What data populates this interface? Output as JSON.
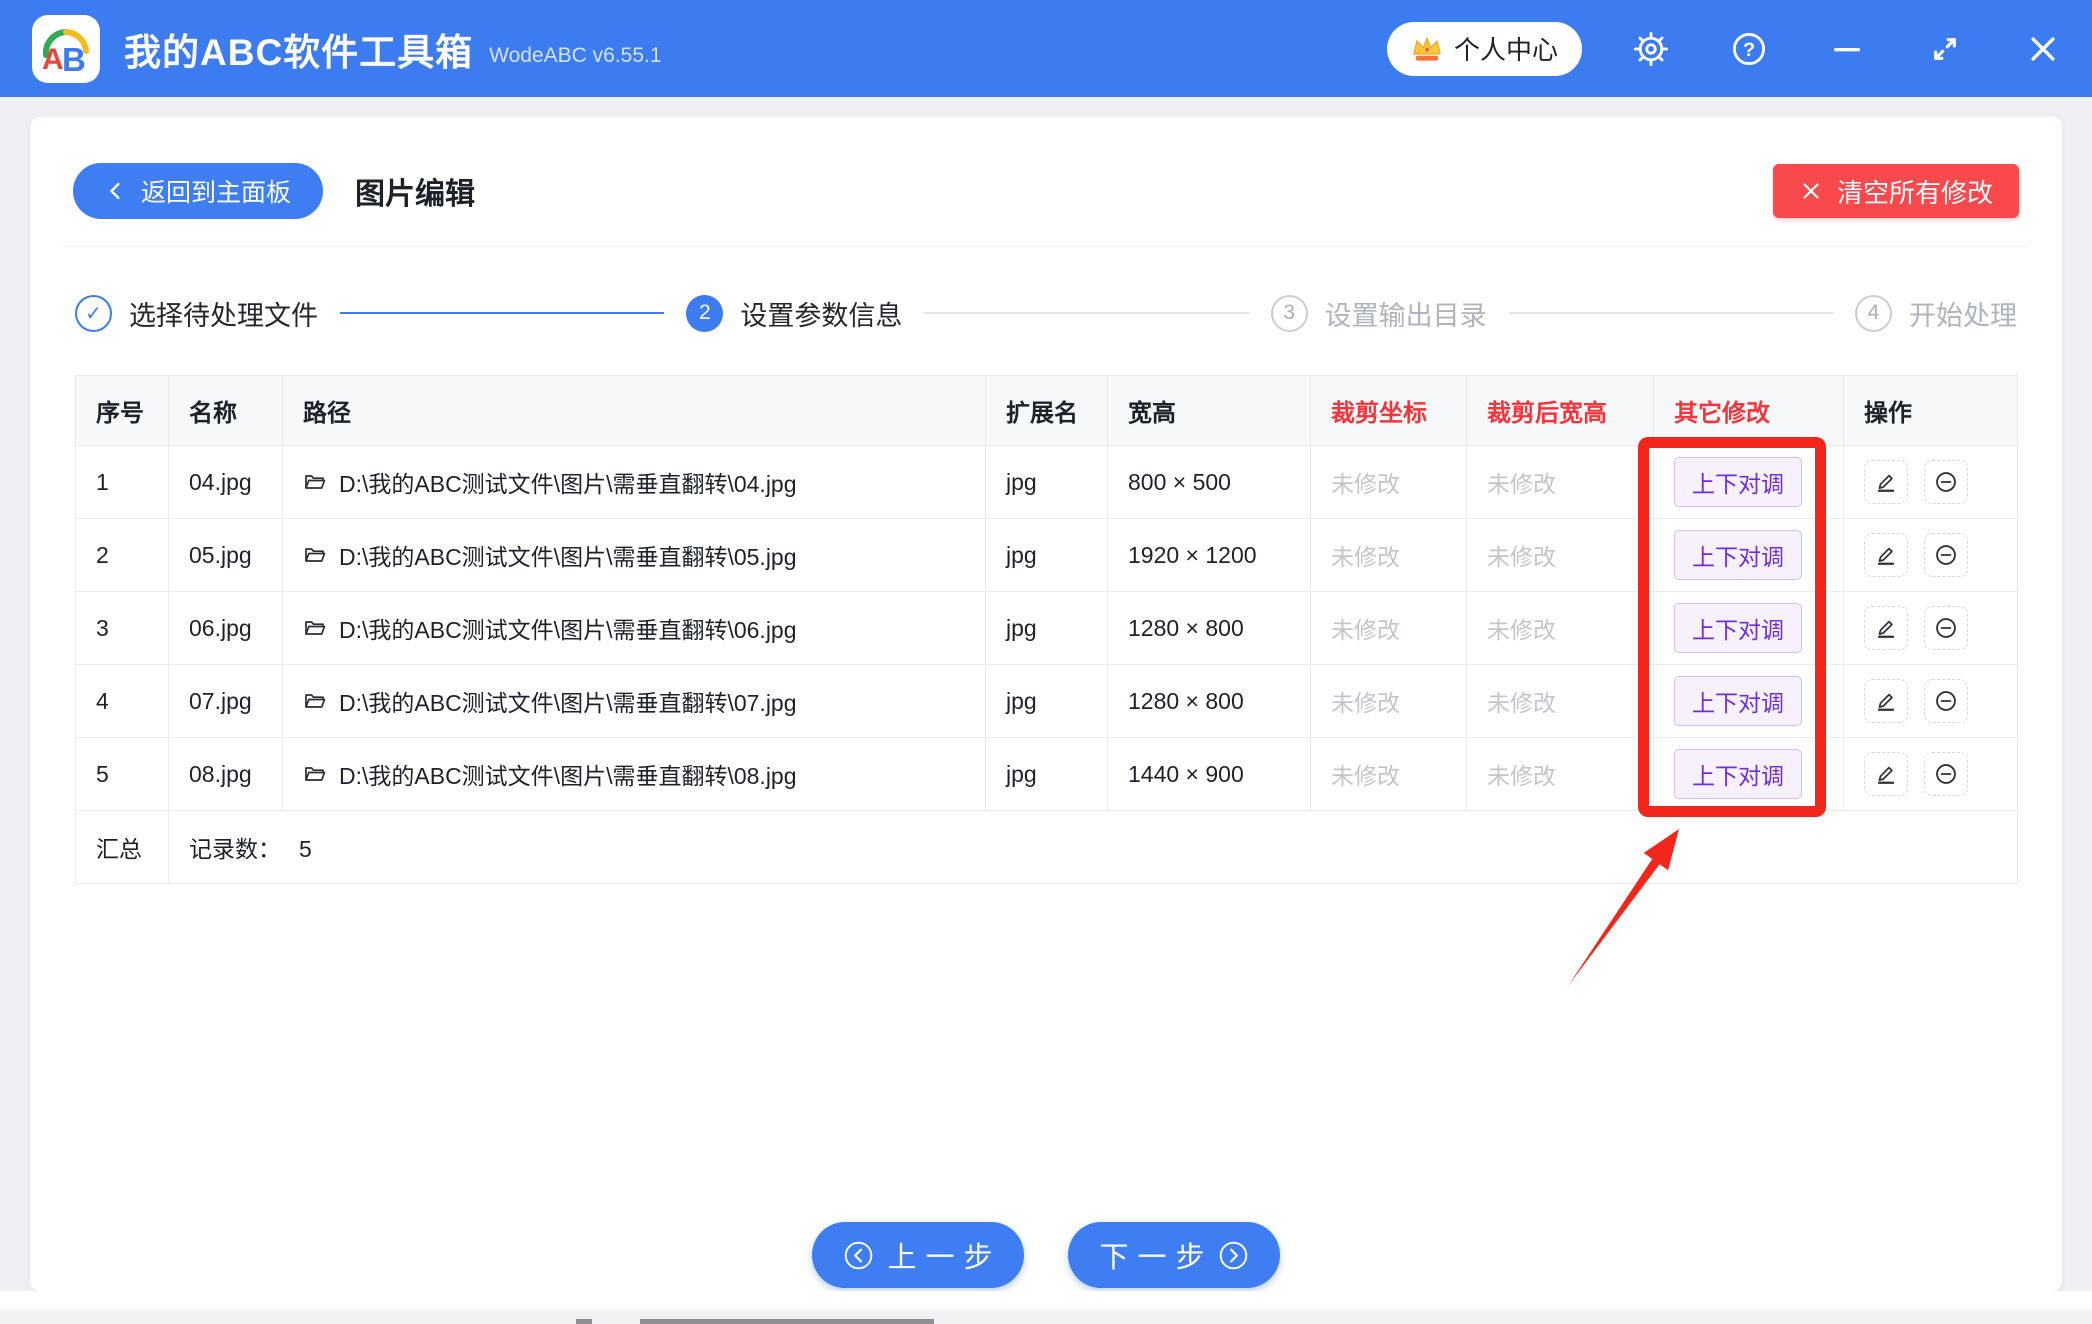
{
  "colors": {
    "accent": "#3C7BF0",
    "danger": "#F9494D",
    "annotation_red": "#F3261B",
    "header_red": "#F5353B",
    "badge_text": "#6C2FD9",
    "badge_bg": "#F7F1FE"
  },
  "header": {
    "app_title": "我的ABC软件工具箱",
    "version": "WodeABC v6.55.1",
    "personal_center": "个人中心",
    "logo_text": "AB"
  },
  "toolbar": {
    "back_label": "返回到主面板",
    "page_title": "图片编辑",
    "clear_label": "清空所有修改"
  },
  "steps": {
    "check": "✓",
    "s1_label": "选择待处理文件",
    "s2_num": "2",
    "s2_label": "设置参数信息",
    "s3_num": "3",
    "s3_label": "设置输出目录",
    "s4_num": "4",
    "s4_label": "开始处理"
  },
  "table": {
    "headers": {
      "index": "序号",
      "name": "名称",
      "path": "路径",
      "ext": "扩展名",
      "size": "宽高",
      "crop_pos": "裁剪坐标",
      "crop_size": "裁剪后宽高",
      "other": "其它修改",
      "actions": "操作"
    },
    "rows": [
      {
        "index": "1",
        "name": "04.jpg",
        "path": "D:\\我的ABC测试文件\\图片\\需垂直翻转\\04.jpg",
        "ext": "jpg",
        "size": "800 × 500",
        "crop_pos": "未修改",
        "crop_size": "未修改",
        "other": "上下对调"
      },
      {
        "index": "2",
        "name": "05.jpg",
        "path": "D:\\我的ABC测试文件\\图片\\需垂直翻转\\05.jpg",
        "ext": "jpg",
        "size": "1920 × 1200",
        "crop_pos": "未修改",
        "crop_size": "未修改",
        "other": "上下对调"
      },
      {
        "index": "3",
        "name": "06.jpg",
        "path": "D:\\我的ABC测试文件\\图片\\需垂直翻转\\06.jpg",
        "ext": "jpg",
        "size": "1280 × 800",
        "crop_pos": "未修改",
        "crop_size": "未修改",
        "other": "上下对调"
      },
      {
        "index": "4",
        "name": "07.jpg",
        "path": "D:\\我的ABC测试文件\\图片\\需垂直翻转\\07.jpg",
        "ext": "jpg",
        "size": "1280 × 800",
        "crop_pos": "未修改",
        "crop_size": "未修改",
        "other": "上下对调"
      },
      {
        "index": "5",
        "name": "08.jpg",
        "path": "D:\\我的ABC测试文件\\图片\\需垂直翻转\\08.jpg",
        "ext": "jpg",
        "size": "1440 × 900",
        "crop_pos": "未修改",
        "crop_size": "未修改",
        "other": "上下对调"
      }
    ],
    "summary": {
      "label": "汇总",
      "records_label": "记录数：",
      "records_value": "5"
    }
  },
  "footer": {
    "prev_label": "上一步",
    "next_label": "下一步"
  }
}
